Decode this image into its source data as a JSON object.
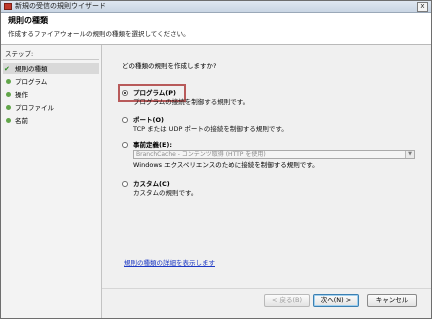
{
  "window": {
    "title": "新規の受信の規則ウイザード",
    "close_symbol": "x"
  },
  "header": {
    "title": "規則の種類",
    "description": "作成するファイアウォールの規則の種類を選択してください。"
  },
  "sidebar": {
    "steps_label": "ステップ:",
    "items": [
      {
        "label": "規則の種類",
        "state": "current"
      },
      {
        "label": "プログラム",
        "state": "pending"
      },
      {
        "label": "操作",
        "state": "pending"
      },
      {
        "label": "プロファイル",
        "state": "pending"
      },
      {
        "label": "名前",
        "state": "pending"
      }
    ]
  },
  "main": {
    "question": "どの種類の規則を作成しますか?",
    "options": [
      {
        "label": "プログラム(P)",
        "description": "プログラムの接続を制御する規則です。",
        "selected": true
      },
      {
        "label": "ポート(O)",
        "description": "TCP または UDP ポートの接続を制御する規則です。",
        "selected": false
      },
      {
        "label": "事前定義(E):",
        "description": "Windows エクスペリエンスのために接続を制御する規則です。",
        "selected": false,
        "dropdown_value": "BranchCache - コンテンツ取得 (HTTP を使用)"
      },
      {
        "label": "カスタム(C)",
        "description": "カスタムの規則です。",
        "selected": false
      }
    ],
    "link": "規則の種類の詳細を表示します"
  },
  "buttons": {
    "back": "< 戻る(B)",
    "next": "次へ(N) >",
    "cancel": "キャンセル"
  },
  "colors": {
    "highlight": "#b85a5a",
    "link": "#1d39c4",
    "step_bullet": "#62a64a"
  }
}
